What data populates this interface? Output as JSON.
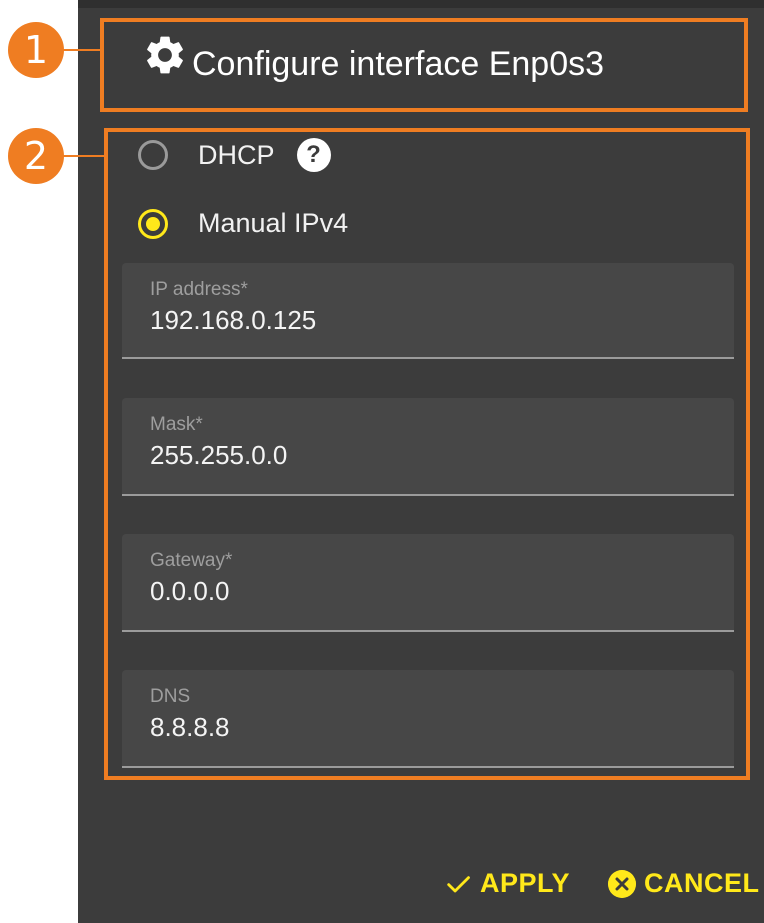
{
  "callouts": {
    "one": "1",
    "two": "2"
  },
  "dialog": {
    "title": "Configure interface Enp0s3",
    "title_icon": "gear-icon"
  },
  "mode": {
    "options": [
      {
        "label": "DHCP",
        "selected": false,
        "help_icon": "question-icon"
      },
      {
        "label": "Manual IPv4",
        "selected": true
      }
    ]
  },
  "fields": [
    {
      "label": "IP address*",
      "value": "192.168.0.125"
    },
    {
      "label": "Mask*",
      "value": "255.255.0.0"
    },
    {
      "label": "Gateway*",
      "value": "0.0.0.0"
    },
    {
      "label": "DNS",
      "value": "8.8.8.8"
    }
  ],
  "actions": {
    "apply_label": "APPLY",
    "cancel_label": "CANCEL"
  },
  "colors": {
    "accent": "#ffe81a",
    "callout": "#ef7d22",
    "panel": "#3c3c3c"
  }
}
